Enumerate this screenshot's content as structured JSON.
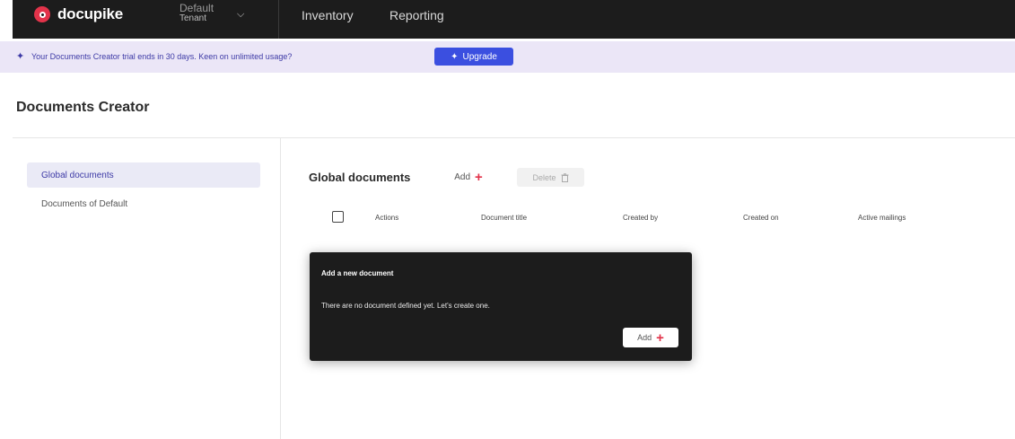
{
  "navbar": {
    "logo_text": "docupike",
    "tenant_line1": "Default",
    "tenant_line2": "Tenant",
    "items": [
      "Inventory",
      "Reporting"
    ]
  },
  "banner": {
    "text": "Your Documents Creator trial ends in 30 days. Keen on unlimited usage?",
    "upgrade_label": "Upgrade"
  },
  "page": {
    "title": "Documents Creator"
  },
  "sidebar": {
    "items": [
      {
        "label": "Global documents",
        "active": true
      },
      {
        "label": "Documents of Default",
        "active": false
      }
    ]
  },
  "main": {
    "title": "Global documents",
    "add_label": "Add",
    "delete_label": "Delete",
    "columns": [
      "Actions",
      "Document title",
      "Created by",
      "Created on",
      "Active mailings"
    ]
  },
  "empty_card": {
    "title": "Add a new document",
    "message": "There are no document defined yet. Let's create one.",
    "add_label": "Add"
  },
  "colors": {
    "navbar_bg": "#1c1c1c",
    "brand_red": "#e2334a",
    "accent_blue": "#3b4fe0",
    "banner_bg": "#ebe6f7"
  }
}
